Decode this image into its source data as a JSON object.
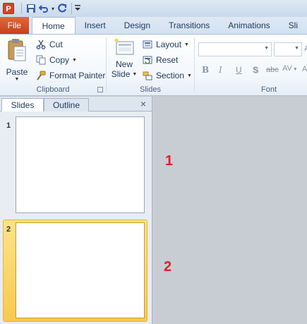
{
  "quick_access": {
    "app_icon_letter": "P",
    "icons": [
      "powerpoint-app-icon",
      "save-icon",
      "undo-icon",
      "redo-icon",
      "customize-qat-icon"
    ]
  },
  "ribbon_tabs": [
    {
      "label": "File"
    },
    {
      "label": "Home"
    },
    {
      "label": "Insert"
    },
    {
      "label": "Design"
    },
    {
      "label": "Transitions"
    },
    {
      "label": "Animations"
    },
    {
      "label": "Sli"
    }
  ],
  "clipboard": {
    "paste_label": "Paste",
    "cut_label": "Cut",
    "copy_label": "Copy",
    "format_painter_label": "Format Painter",
    "group_label": "Clipboard"
  },
  "slides_group": {
    "new_slide_line1": "New",
    "new_slide_line2": "Slide",
    "layout_label": "Layout",
    "reset_label": "Reset",
    "section_label": "Section",
    "group_label": "Slides"
  },
  "font_group": {
    "font_name_value": "",
    "font_size_value": "",
    "bold": "B",
    "italic": "I",
    "underline": "U",
    "shadow": "S",
    "strikethrough": "abc",
    "spacing": "AV",
    "case": "Aa",
    "group_label": "Font"
  },
  "slides_pane": {
    "tabs": [
      {
        "label": "Slides"
      },
      {
        "label": "Outline"
      }
    ],
    "close_glyph": "×",
    "slides": [
      {
        "number": "1"
      },
      {
        "number": "2"
      }
    ]
  },
  "annotations": [
    "1",
    "2"
  ],
  "colors": {
    "file_tab": "#d2502a",
    "selection_highlight": "#f8c94f",
    "annotation": "#e0202a"
  }
}
